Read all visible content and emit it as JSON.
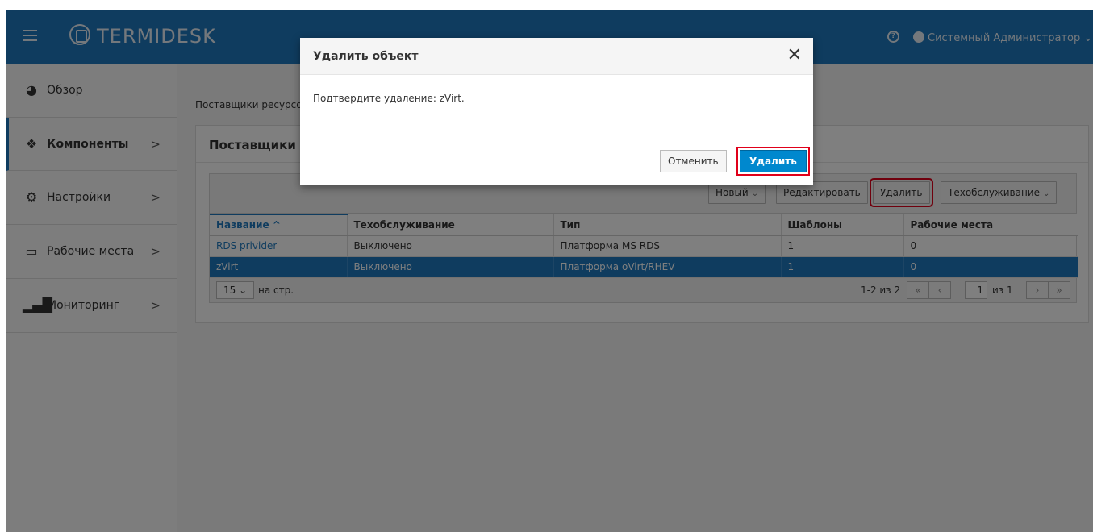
{
  "header": {
    "logo_text": "TERMIDESK",
    "user_name": "Системный Администратор",
    "user_caret": "⌄",
    "help_glyph": "?",
    "colors": {
      "bar": "#1f79bf"
    }
  },
  "sidebar": {
    "items": [
      {
        "label": "Обзор",
        "icon": "dashboard-icon"
      },
      {
        "label": "Компоненты",
        "icon": "cubes-icon",
        "chevron": ">"
      },
      {
        "label": "Настройки",
        "icon": "gears-icon",
        "chevron": ">"
      },
      {
        "label": "Рабочие места",
        "icon": "desktop-icon",
        "chevron": ">"
      },
      {
        "label": "Мониторинг",
        "icon": "bar-chart-icon",
        "chevron": ">"
      }
    ]
  },
  "main": {
    "breadcrumb": "Поставщики ресурсов",
    "panel_title": "Поставщики ресурсов",
    "toolbar": {
      "new_label": "Новый",
      "edit_label": "Редактировать",
      "delete_label": "Удалить",
      "maintenance_label": "Техобслуживание",
      "caret": "⌄"
    },
    "table": {
      "columns": [
        "Название ^",
        "Техобслуживание",
        "Тип",
        "Шаблоны",
        "Рабочие места"
      ],
      "rows": [
        [
          "RDS privider",
          "Выключено",
          "Платформа MS RDS",
          "1",
          "0"
        ],
        [
          "zVirt",
          "Выключено",
          "Платформа oVirt/RHEV",
          "1",
          "0"
        ]
      ]
    },
    "pager": {
      "per_page": "15",
      "per_page_caret": "⌄",
      "per_page_label": "на стр.",
      "range": "1-2 из 2",
      "first": "«",
      "prev": "‹",
      "page": "1",
      "of": "из 1",
      "next": "›",
      "last": "»"
    }
  },
  "modal": {
    "title": "Удалить объект",
    "close": "✕",
    "message": "Подтвердите удаление: zVirt.",
    "cancel_label": "Отменить",
    "confirm_label": "Удалить"
  }
}
